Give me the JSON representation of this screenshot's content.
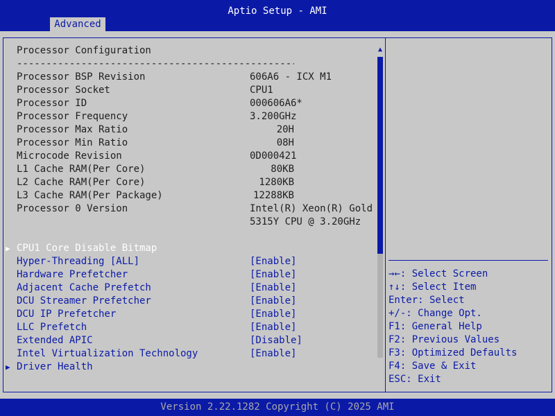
{
  "header": {
    "title": "Aptio Setup - AMI",
    "tabs": [
      {
        "label": "Advanced"
      }
    ]
  },
  "content": {
    "section_title": "Processor Configuration",
    "separator": "------------------------------------------------",
    "info_rows": [
      {
        "label": "Processor BSP Revision",
        "value": "606A6 - ICX M1"
      },
      {
        "label": "Processor Socket",
        "value": "CPU1"
      },
      {
        "label": "Processor ID",
        "value": "000606A6*"
      },
      {
        "label": "Processor Frequency",
        "value": "3.200GHz"
      },
      {
        "label": "Processor Max Ratio",
        "value": "20H"
      },
      {
        "label": "Processor Min Ratio",
        "value": "08H"
      },
      {
        "label": "Microcode Revision",
        "value": "0D000421"
      },
      {
        "label": "L1 Cache RAM(Per Core)",
        "value": "80KB"
      },
      {
        "label": "L2 Cache RAM(Per Core)",
        "value": "1280KB"
      },
      {
        "label": "L3 Cache RAM(Per Package)",
        "value": "12288KB"
      },
      {
        "label": "Processor 0 Version",
        "value": "Intel(R) Xeon(R) Gold",
        "value2": "5315Y CPU @ 3.20GHz"
      }
    ],
    "submenu_cpu1": "CPU1 Core Disable Bitmap",
    "options": [
      {
        "label": "Hyper-Threading [ALL]",
        "value": "[Enable]"
      },
      {
        "label": "Hardware Prefetcher",
        "value": "[Enable]"
      },
      {
        "label": "Adjacent Cache Prefetch",
        "value": "[Enable]"
      },
      {
        "label": "DCU Streamer Prefetcher",
        "value": "[Enable]"
      },
      {
        "label": "DCU IP Prefetcher",
        "value": "[Enable]"
      },
      {
        "label": "LLC Prefetch",
        "value": "[Enable]"
      },
      {
        "label": "Extended APIC",
        "value": "[Disable]"
      },
      {
        "label": "Intel Virtualization Technology",
        "value": "[Enable]"
      }
    ],
    "submenu_driver": "Driver Health",
    "scroll_position": 0
  },
  "help": [
    "→←: Select Screen",
    "↑↓: Select Item",
    "Enter: Select",
    "+/-: Change Opt.",
    "F1: General Help",
    "F2: Previous Values",
    "F3: Optimized Defaults",
    "F4: Save & Exit",
    "ESC: Exit"
  ],
  "footer": {
    "version": "Version 2.22.1282 Copyright (C) 2025 AMI"
  },
  "colors": {
    "bar_blue": "#0b1aa6",
    "panel_gray": "#c8c8c8",
    "selected_text": "#ffffff"
  }
}
